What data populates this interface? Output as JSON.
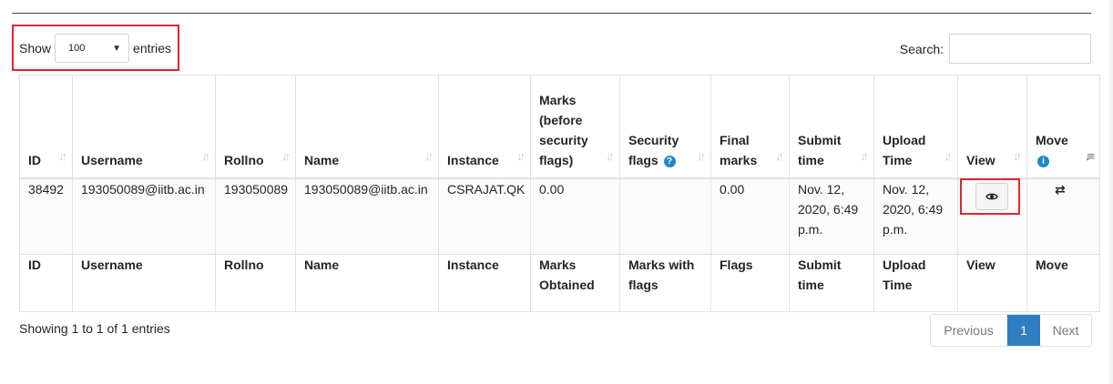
{
  "length": {
    "prefix": "Show",
    "value": "100",
    "suffix": "entries"
  },
  "search": {
    "label": "Search:",
    "value": ""
  },
  "headers": [
    "ID",
    "Username",
    "Rollno",
    "Name",
    "Instance",
    "Marks (before security flags)",
    "Security flags",
    "Final marks",
    "Submit time",
    "Upload Time",
    "View",
    "Move"
  ],
  "row": {
    "id": "38492",
    "username": "193050089@iitb.ac.in",
    "rollno": "193050089",
    "name": "193050089@iitb.ac.in",
    "instance": "CSRAJAT.QK",
    "marks_before": "0.00",
    "security_flags": "",
    "final_marks": "0.00",
    "submit_time": "Nov. 12, 2020, 6:49 p.m.",
    "upload_time": "Nov. 12, 2020, 6:49 p.m."
  },
  "footers": [
    "ID",
    "Username",
    "Rollno",
    "Name",
    "Instance",
    "Marks Obtained",
    "Marks with flags",
    "Flags",
    "Submit time",
    "Upload Time",
    "View",
    "Move"
  ],
  "info_text": "Showing 1 to 1 of 1 entries",
  "pager": {
    "previous": "Previous",
    "current": "1",
    "next": "Next"
  },
  "colors": {
    "highlight": "#e0262e",
    "accent": "#2f7ec2"
  },
  "icons": {
    "view": "eye-icon",
    "move": "transfer-icon",
    "info": "info-icon",
    "help": "help-icon"
  }
}
